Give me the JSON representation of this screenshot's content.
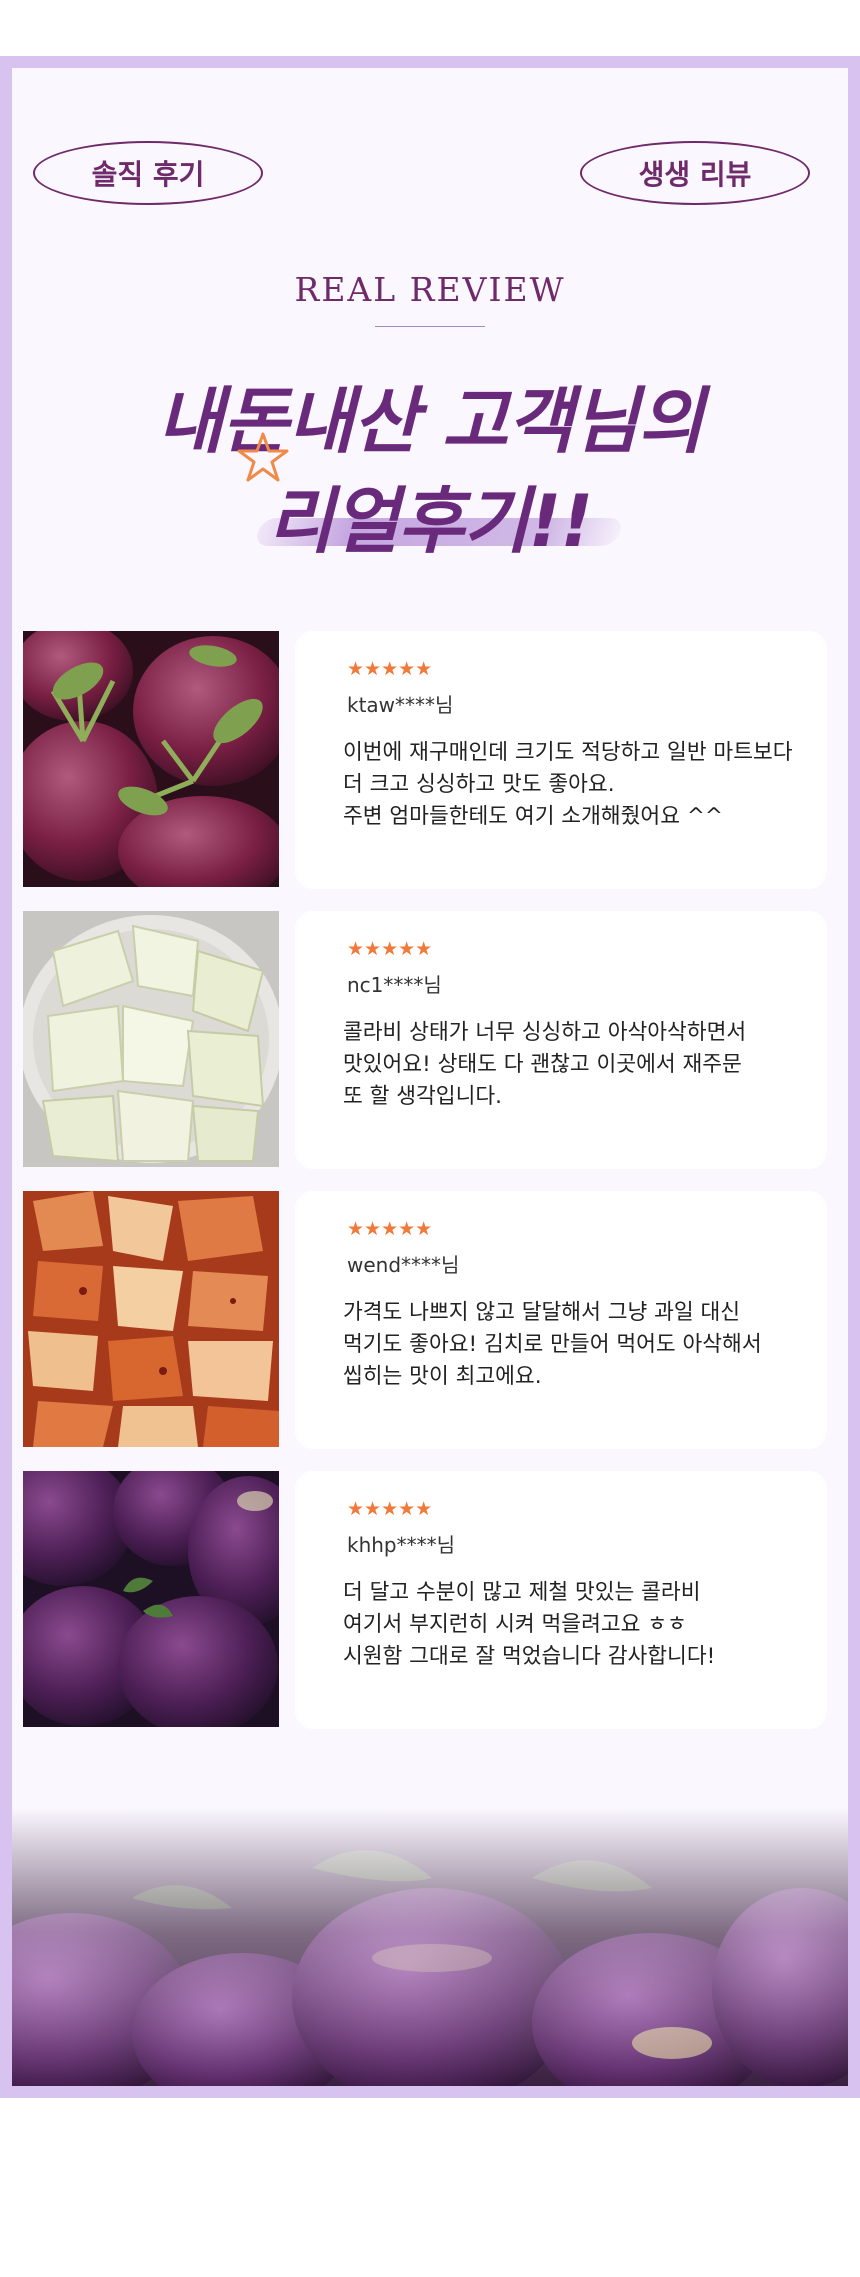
{
  "tags": {
    "left": "솔직 후기",
    "right": "생생 리뷰"
  },
  "heading": {
    "eyebrow": "REAL REVIEW",
    "line1": "내돈내산 고객님의",
    "line2": "리얼후기!!"
  },
  "colors": {
    "accent": "#6e2a6a",
    "headline": "#6a2a7c",
    "frame": "#d8c2ef",
    "star": "#f07a3a"
  },
  "reviews": [
    {
      "photo": "whole-kohlrabi-photo",
      "stars": "★★★★★",
      "rating": 5,
      "reviewer": "ktaw****님",
      "lines": [
        "이번에 재구매인데 크기도 적당하고 일반 마트보다",
        "더 크고 싱싱하고 맛도 좋아요.",
        "주변 엄마들한테도 여기 소개해줬어요 ^^"
      ]
    },
    {
      "photo": "sliced-kohlrabi-photo",
      "stars": "★★★★★",
      "rating": 5,
      "reviewer": "nc1****님",
      "lines": [
        "콜라비 상태가 너무 싱싱하고 아삭아삭하면서",
        "맛있어요! 상태도 다 괜찮고 이곳에서 재주문",
        "또 할 생각입니다."
      ]
    },
    {
      "photo": "kohlrabi-kimchi-photo",
      "stars": "★★★★★",
      "rating": 5,
      "reviewer": "wend****님",
      "lines": [
        "가격도 나쁘지 않고 달달해서 그냥 과일 대신",
        "먹기도 좋아요! 김치로 만들어 먹어도 아삭해서",
        "씹히는 맛이 최고에요."
      ]
    },
    {
      "photo": "purple-kohlrabi-photo",
      "stars": "★★★★★",
      "rating": 5,
      "reviewer": "khhp****님",
      "lines": [
        "더 달고 수분이 많고 제철 맛있는 콜라비",
        "여기서 부지런히 시켜 먹을려고요 ㅎㅎ",
        "시원함 그대로 잘 먹었습니다 감사합니다!"
      ]
    }
  ]
}
